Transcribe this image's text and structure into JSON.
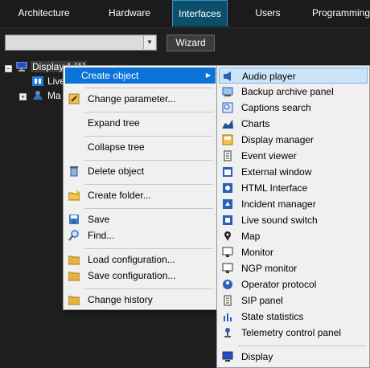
{
  "tabs": [
    "Architecture",
    "Hardware",
    "Interfaces",
    "Users",
    "Programming"
  ],
  "active_tab": "Interfaces",
  "toolbar": {
    "combo_value": "",
    "wizard_label": "Wizard"
  },
  "tree": {
    "root": "Display 1 [1]",
    "child1": "Live",
    "child2": "Ma"
  },
  "context_menu": [
    "Create object",
    "Change parameter...",
    "Expand tree",
    "Collapse tree",
    "Delete object",
    "Create folder...",
    "Save",
    "Find...",
    "Load configuration...",
    "Save configuration...",
    "Change history"
  ],
  "submenu": [
    "Audio player",
    "Backup archive panel",
    "Captions search",
    "Charts",
    "Display manager",
    "Event viewer",
    "External window",
    "HTML Interface",
    "Incident manager",
    "Live sound switch",
    "Map",
    "Monitor",
    "NGP monitor",
    "Operator protocol",
    "SIP panel",
    "State statistics",
    "Telemetry control panel",
    "Display"
  ],
  "colors": {
    "highlight": "#0a74d8",
    "active_tab": "#0b4f6c",
    "menu_bg": "#f0f0f0"
  }
}
